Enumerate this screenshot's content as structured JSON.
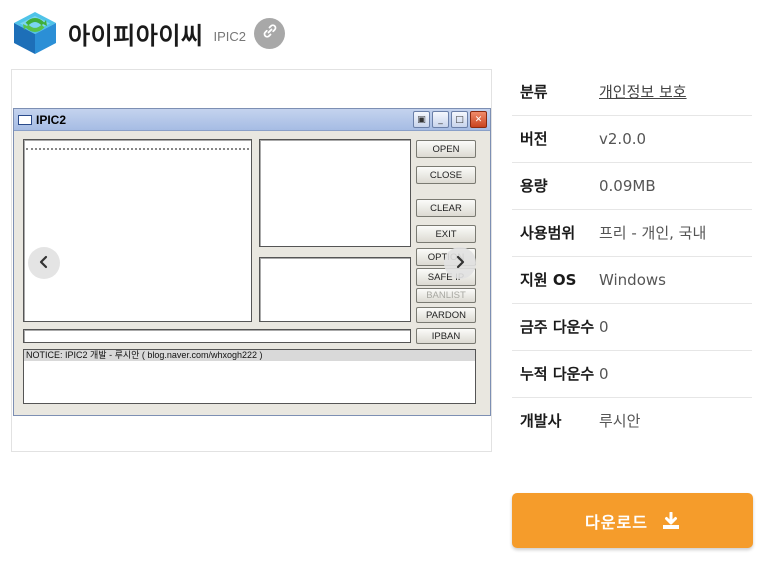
{
  "header": {
    "title": "아이피아이씨",
    "subtitle": "IPIC2",
    "logo_icon": "app-logo-cube-icon",
    "link_icon": "link-icon"
  },
  "preview": {
    "window_title": "IPIC2",
    "buttons": {
      "open": "OPEN",
      "close": "CLOSE",
      "clear": "CLEAR",
      "exit": "EXIT",
      "option": "OPTION",
      "safe_ip": "SAFE IP",
      "banlist": "BANLIST",
      "pardon": "PARDON",
      "ipban": "IPBAN"
    },
    "notice": "NOTICE: IPIC2 개발 - 루시안 ( blog.naver.com/whxogh222 )",
    "prev_icon": "chevron-left-icon",
    "next_icon": "chevron-right-icon"
  },
  "info": [
    {
      "label": "분류",
      "value": "개인정보 보호",
      "link": true
    },
    {
      "label": "버전",
      "value": "v2.0.0",
      "link": false
    },
    {
      "label": "용량",
      "value": "0.09MB",
      "link": false
    },
    {
      "label": "사용범위",
      "value": "프리 - 개인, 국내",
      "link": false
    },
    {
      "label": "지원 OS",
      "value": "Windows",
      "link": false
    },
    {
      "label": "금주 다운수",
      "value": "0",
      "link": false
    },
    {
      "label": "누적 다운수",
      "value": "0",
      "link": false
    },
    {
      "label": "개발사",
      "value": "루시안",
      "link": false
    }
  ],
  "download": {
    "label": "다운로드",
    "icon": "download-icon"
  },
  "colors": {
    "accent": "#f59c2b",
    "link_button": "#a8a8a8"
  }
}
